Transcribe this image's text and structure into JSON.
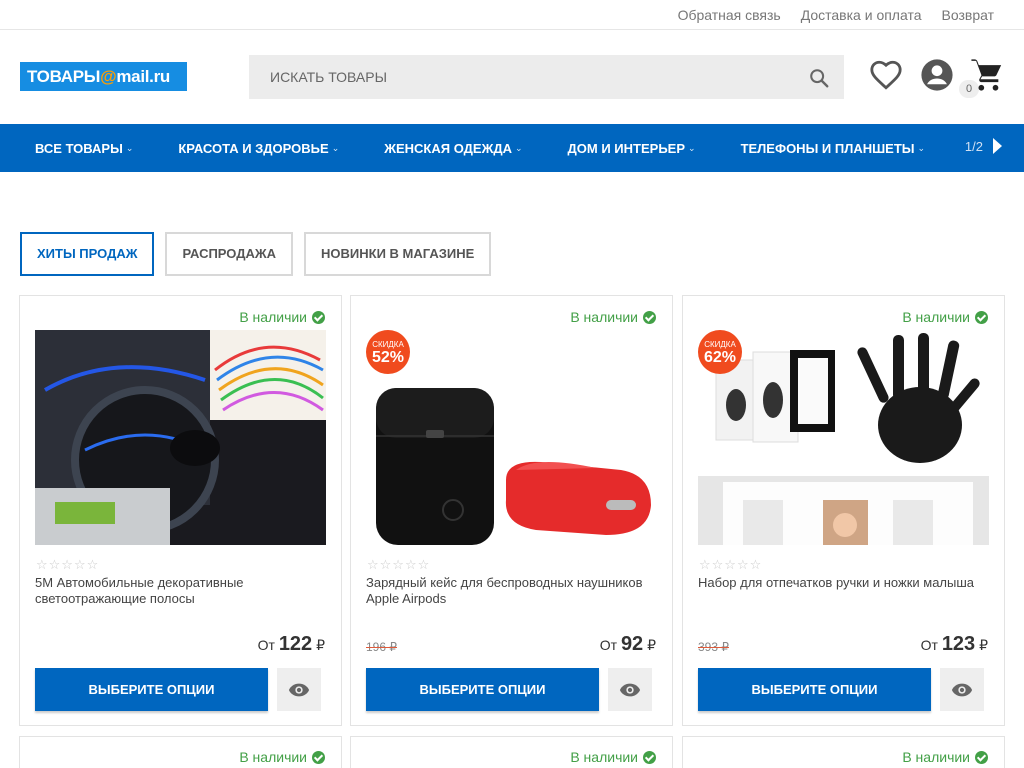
{
  "topbar": {
    "links": [
      "Обратная связь",
      "Доставка и оплата",
      "Возврат"
    ]
  },
  "header": {
    "logo_left": "ТОВАРЫ",
    "logo_at": "@",
    "logo_right": "mail.ru",
    "search_placeholder": "ИСКАТЬ ТОВАРЫ",
    "cart_count": "0",
    "icons": [
      "heart-icon",
      "account-icon",
      "cart-icon",
      "search-icon"
    ]
  },
  "nav": {
    "items": [
      "ВСЕ ТОВАРЫ",
      "КРАСОТА И ЗДОРОВЬЕ",
      "ЖЕНСКАЯ ОДЕЖДА",
      "ДОМ И ИНТЕРЬЕР",
      "ТЕЛЕФОНЫ И ПЛАНШЕТЫ"
    ],
    "pager": "1/2"
  },
  "tabs": [
    "ХИТЫ ПРОДАЖ",
    "РАСПРОДАЖА",
    "НОВИНКИ В МАГАЗИНЕ"
  ],
  "products": [
    {
      "stock": "В наличии",
      "title": "5M Автомобильные декоративные светоотражающие полосы",
      "price_prefix": "От",
      "price": "122",
      "currency": "₽",
      "old_price": "",
      "badge_text": "",
      "badge_value": "",
      "rating": 0,
      "button": "ВЫБЕРИТЕ ОПЦИИ"
    },
    {
      "stock": "В наличии",
      "title": "Зарядный кейс для беспроводных наушников Apple Airpods",
      "price_prefix": "От",
      "price": "92",
      "currency": "₽",
      "old_price": "196 ₽",
      "badge_text": "СКИДКА",
      "badge_value": "52%",
      "rating": 0,
      "button": "ВЫБЕРИТЕ ОПЦИИ"
    },
    {
      "stock": "В наличии",
      "title": "Набор для отпечатков ручки и ножки малыша",
      "price_prefix": "От",
      "price": "123",
      "currency": "₽",
      "old_price": "393 ₽",
      "badge_text": "СКИДКА",
      "badge_value": "62%",
      "rating": 0,
      "button": "ВЫБЕРИТЕ ОПЦИИ"
    }
  ],
  "next_row": {
    "stock": [
      "В наличии",
      "В наличии",
      "В наличии"
    ]
  },
  "colors": {
    "primary": "#0066bf",
    "logo_bg": "#168de2",
    "in_stock": "#43a047",
    "sale_badge": "#f04b1e"
  }
}
